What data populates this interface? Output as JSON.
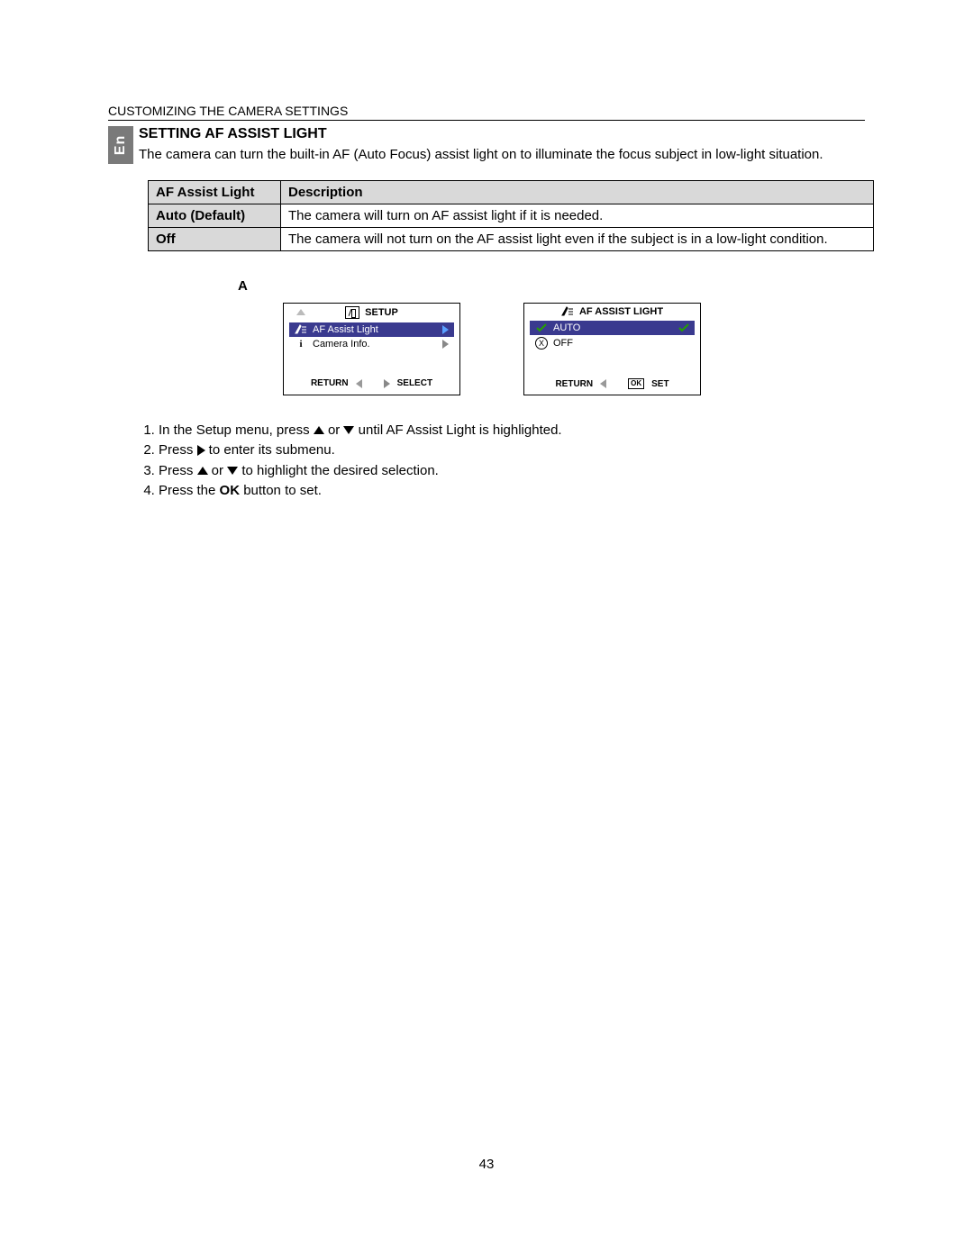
{
  "section_header": "CUSTOMIZING THE CAMERA SETTINGS",
  "lang_tab": "En",
  "heading": "SETTING AF ASSIST LIGHT",
  "description": "The camera can turn the built-in AF (Auto Focus) assist light on to illuminate the focus subject in low-light situation.",
  "table": {
    "headers": [
      "AF Assist Light",
      "Description"
    ],
    "rows": [
      {
        "key": "Auto (Default)",
        "desc": "The camera will turn on AF assist light if it is needed."
      },
      {
        "key": "Off",
        "desc": "The camera will not turn on the AF assist light even if the subject is in a low-light condition."
      }
    ]
  },
  "letter": "A",
  "panel1": {
    "title": "SETUP",
    "items": [
      {
        "icon": "beam",
        "label": "AF Assist Light",
        "highlight": true,
        "tail": "blue"
      },
      {
        "icon": "info",
        "label": "Camera Info.",
        "highlight": false,
        "tail": "grey"
      }
    ],
    "footer_left": "RETURN",
    "footer_right": "SELECT"
  },
  "panel2": {
    "title": "AF ASSIST LIGHT",
    "items": [
      {
        "icon": "check",
        "label": "AUTO",
        "highlight": true,
        "tail": "check"
      },
      {
        "icon": "x",
        "label": "OFF",
        "highlight": false,
        "tail": ""
      }
    ],
    "footer_left": "RETURN",
    "footer_right": "SET",
    "footer_badge": "OK"
  },
  "steps": {
    "s1a": "In the Setup menu, press ",
    "s1b": " or ",
    "s1c": " until AF Assist Light is highlighted.",
    "s2a": "Press ",
    "s2b": " to enter its submenu.",
    "s3a": "Press ",
    "s3b": " or ",
    "s3c": " to highlight the desired selection.",
    "s4a": "Press the ",
    "s4b": "OK",
    "s4c": " button to set."
  },
  "page_number": "43"
}
